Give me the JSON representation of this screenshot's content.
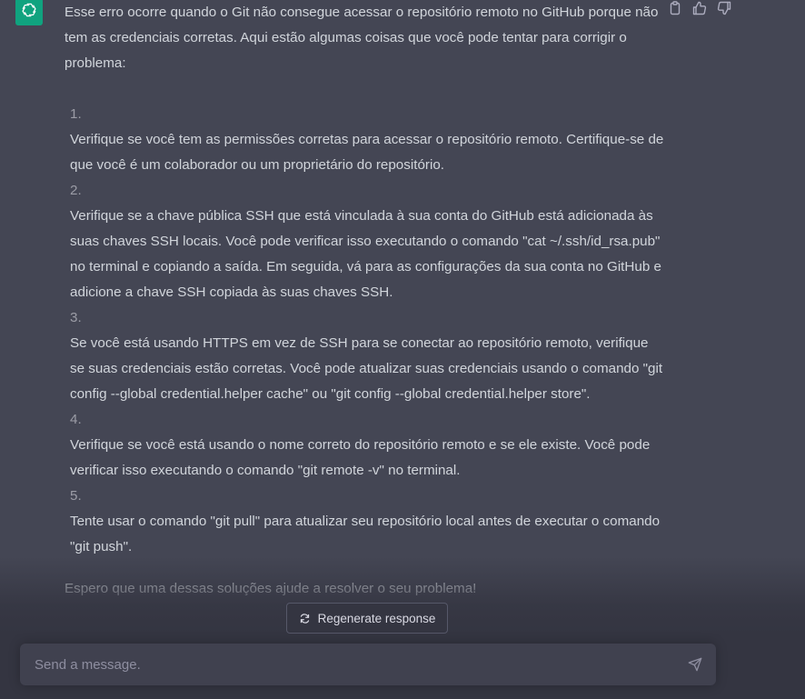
{
  "assistant": {
    "avatar_icon": "openai-logo-icon",
    "avatar_color": "#10a37f"
  },
  "message": {
    "intro": "Esse erro ocorre quando o Git não consegue acessar o repositório remoto no GitHub porque não tem as credenciais corretas. Aqui estão algumas coisas que você pode tentar para corrigir o problema:",
    "items": [
      {
        "number": "1.",
        "text": "Verifique se você tem as permissões corretas para acessar o repositório remoto. Certifique-se de que você é um colaborador ou um proprietário do repositório."
      },
      {
        "number": "2.",
        "text": "Verifique se a chave pública SSH que está vinculada à sua conta do GitHub está adicionada às suas chaves SSH locais. Você pode verificar isso executando o comando \"cat ~/.ssh/id_rsa.pub\" no terminal e copiando a saída. Em seguida, vá para as configurações da sua conta no GitHub e adicione a chave SSH copiada às suas chaves SSH."
      },
      {
        "number": "3.",
        "text": "Se você está usando HTTPS em vez de SSH para se conectar ao repositório remoto, verifique se suas credenciais estão corretas. Você pode atualizar suas credenciais usando o comando \"git config --global credential.helper cache\" ou \"git config --global credential.helper store\"."
      },
      {
        "number": "4.",
        "text": "Verifique se você está usando o nome correto do repositório remoto e se ele existe. Você pode verificar isso executando o comando \"git remote -v\" no terminal."
      },
      {
        "number": "5.",
        "text": "Tente usar o comando \"git pull\" para atualizar seu repositório local antes de executar o comando \"git push\"."
      }
    ],
    "outro": "Espero que uma dessas soluções ajude a resolver o seu problema!"
  },
  "actions": {
    "copy_icon": "clipboard-icon",
    "thumbs_up_icon": "thumbs-up-icon",
    "thumbs_down_icon": "thumbs-down-icon"
  },
  "regenerate": {
    "label": "Regenerate response",
    "icon": "refresh-icon"
  },
  "composer": {
    "placeholder": "Send a message.",
    "value": "",
    "send_icon": "send-icon"
  }
}
